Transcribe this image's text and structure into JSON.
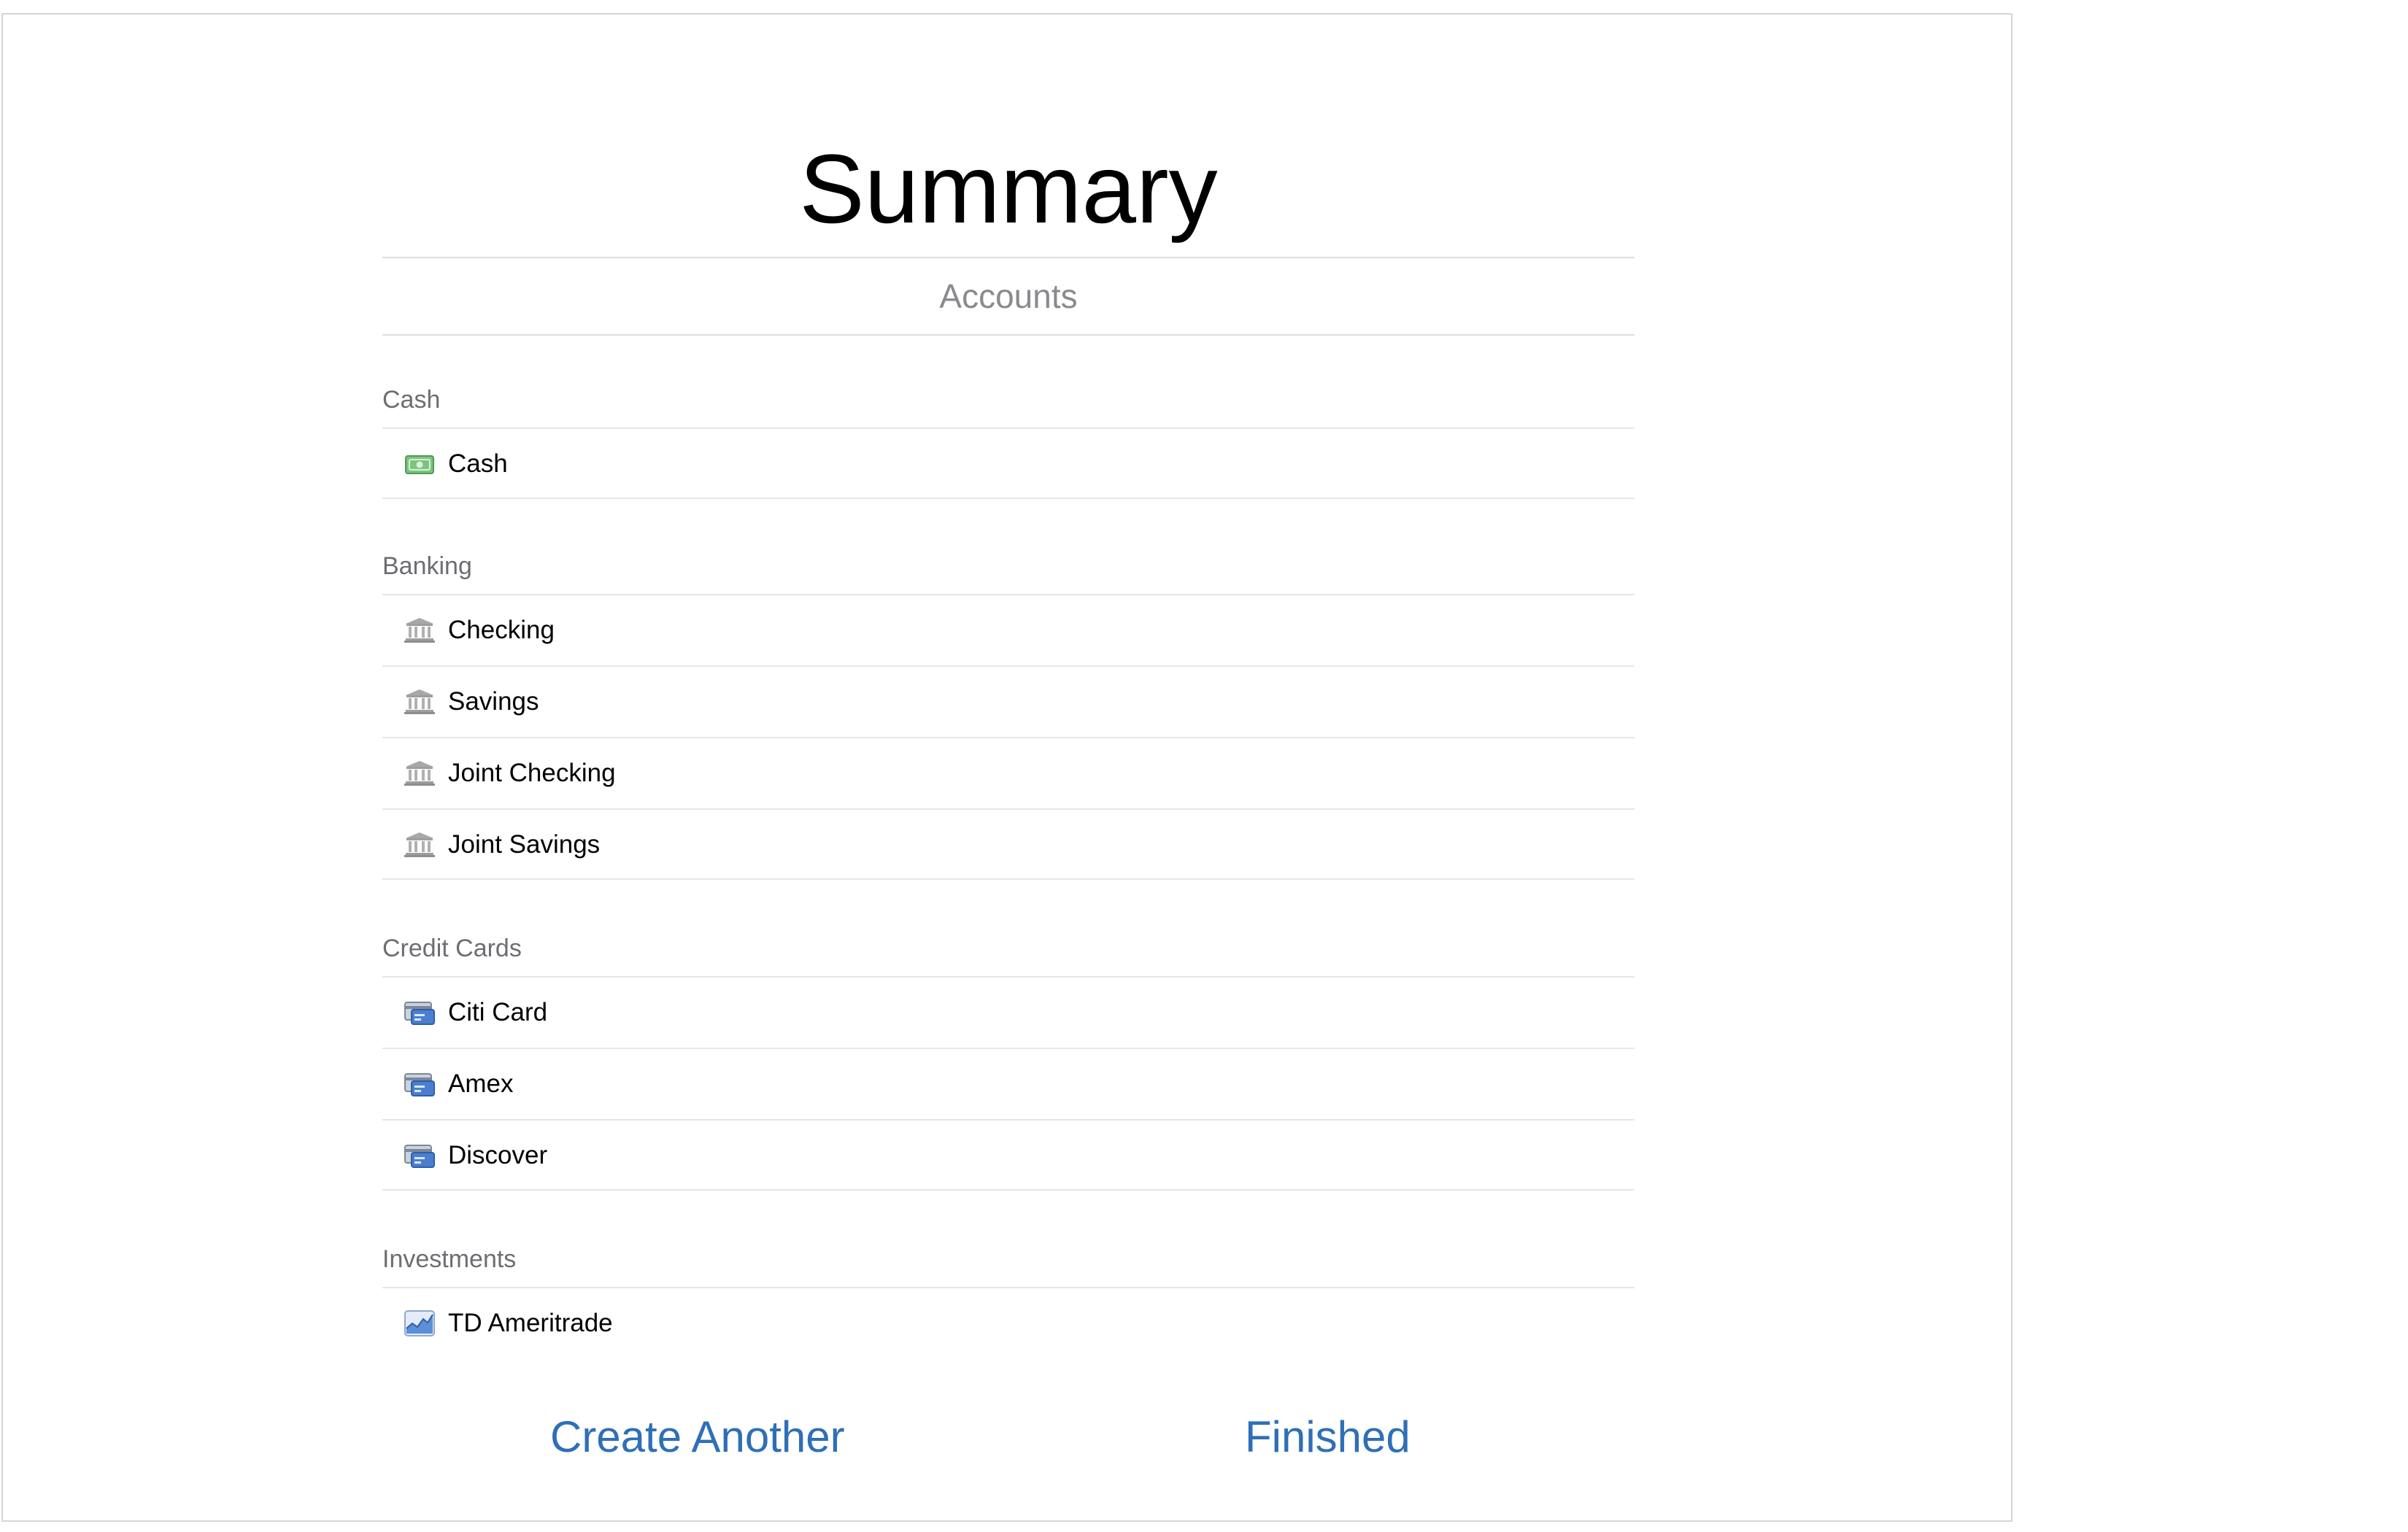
{
  "header": {
    "title": "Summary",
    "subtitle": "Accounts"
  },
  "sections": [
    {
      "header": "Cash",
      "items": [
        {
          "label": "Cash",
          "icon": "cash-icon"
        }
      ]
    },
    {
      "header": "Banking",
      "items": [
        {
          "label": "Checking",
          "icon": "bank-icon"
        },
        {
          "label": "Savings",
          "icon": "bank-icon"
        },
        {
          "label": "Joint Checking",
          "icon": "bank-icon"
        },
        {
          "label": "Joint Savings",
          "icon": "bank-icon"
        }
      ]
    },
    {
      "header": "Credit Cards",
      "items": [
        {
          "label": "Citi Card",
          "icon": "credit-card-icon"
        },
        {
          "label": "Amex",
          "icon": "credit-card-icon"
        },
        {
          "label": "Discover",
          "icon": "credit-card-icon"
        }
      ]
    },
    {
      "header": "Investments",
      "items": [
        {
          "label": "TD Ameritrade",
          "icon": "investment-chart-icon"
        }
      ]
    }
  ],
  "actions": {
    "create_another": "Create Another",
    "finished": "Finished"
  },
  "colors": {
    "accent": "#2e6fb7",
    "section_header": "#6d6d72",
    "subtitle": "#8a8a8e",
    "cash_icon": "#7cc47f",
    "bank_icon": "#9e9e9e",
    "card_icon": "#4a7fd0",
    "investment_icon": "#5b8fd6"
  }
}
